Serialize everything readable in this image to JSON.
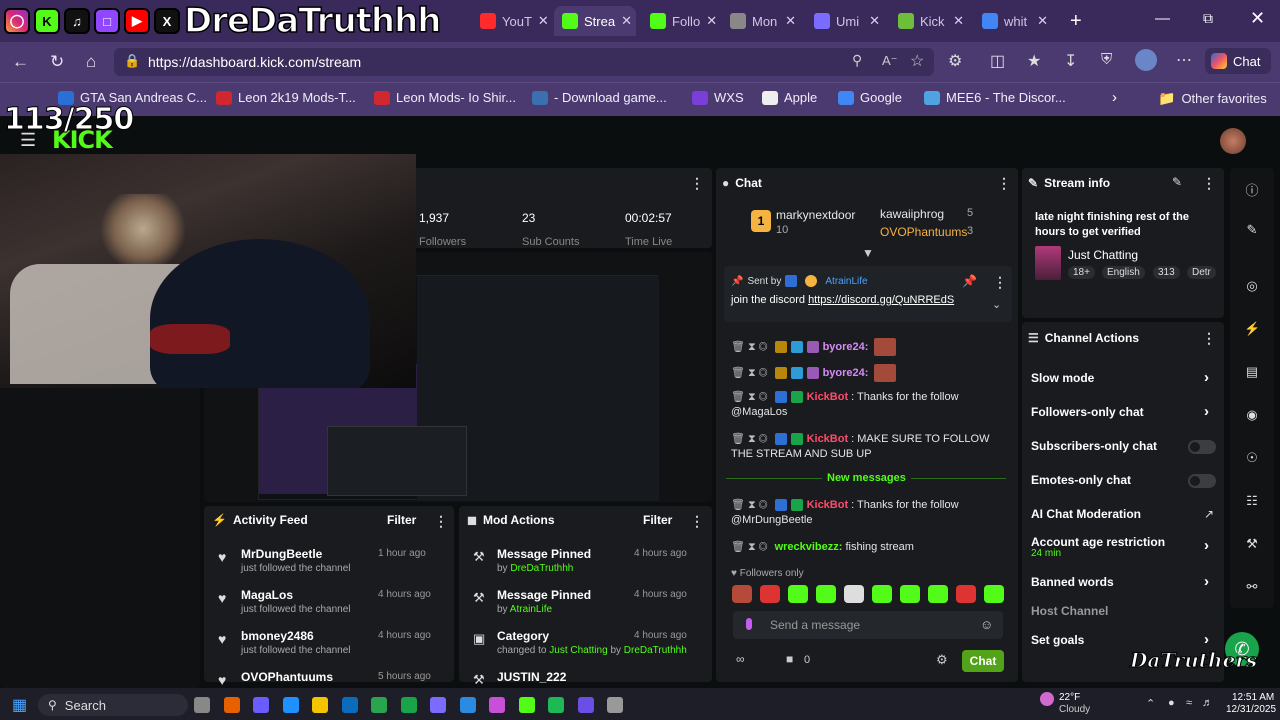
{
  "overlay": {
    "channel_name": "DreDaTruthhh",
    "goal_counter": "113/250",
    "social_icons": [
      "instagram-icon",
      "kick-icon",
      "tiktok-icon",
      "twitch-icon",
      "youtube-icon",
      "x-icon"
    ],
    "watermark": "DaTruthers"
  },
  "browser": {
    "tabs": [
      {
        "label": "YouT",
        "active": false,
        "color": "#ff2b2b"
      },
      {
        "label": "Strea",
        "active": true,
        "color": "#53fc18"
      },
      {
        "label": "Follo",
        "active": false,
        "color": "#53fc18"
      },
      {
        "label": "Mon",
        "active": false,
        "color": "#888888"
      },
      {
        "label": "Umi",
        "active": false,
        "color": "#7a6cff"
      },
      {
        "label": "Kick",
        "active": false,
        "color": "#6fbe3a"
      },
      {
        "label": "whit",
        "active": false,
        "color": "#4285f4"
      }
    ],
    "new_tab": "+",
    "url": "https://dashboard.kick.com/stream",
    "copilot_label": "Chat",
    "bookmarks": [
      {
        "label": "GTA San Andreas C...",
        "color": "#2a6fd6"
      },
      {
        "label": "Leon 2k19 Mods-T...",
        "color": "#d0282e"
      },
      {
        "label": "Leon Mods- Io Shir...",
        "color": "#d0282e"
      },
      {
        "label": "- Download game...",
        "color": "#3a6fb0"
      },
      {
        "label": "WXS",
        "color": "#7a3fd8"
      },
      {
        "label": "Apple",
        "color": "#eeeeee"
      },
      {
        "label": "Google",
        "color": "#4285f4"
      },
      {
        "label": "MEE6 - The Discor...",
        "color": "#4fa3e0"
      }
    ],
    "other_favorites": "Other favorites"
  },
  "dashboard": {
    "logo": "KICK",
    "stats": [
      {
        "value": "1,937",
        "label": "Followers"
      },
      {
        "value": "23",
        "label": "Sub Counts"
      },
      {
        "value": "00:02:57",
        "label": "Time Live"
      }
    ],
    "chat": {
      "title": "Chat",
      "leaderboard": [
        {
          "rank": "1",
          "name": "markynextdoor",
          "count": "10"
        },
        {
          "name": "kawaiiphrog",
          "count": "5"
        },
        {
          "name": "OVOPhantuums",
          "count": "3"
        }
      ],
      "pinned": {
        "sent_by_label": "Sent by",
        "sender": "AtrainLife",
        "text": "join the discord",
        "link": "https://discord.gg/QuNRREdS"
      },
      "messages": [
        {
          "user": "byore24:",
          "text": ""
        },
        {
          "user": "byore24:",
          "text": ""
        },
        {
          "user": "KickBot",
          "text": ": Thanks for the follow @MagaLos"
        },
        {
          "user": "KickBot",
          "text": ": MAKE SURE TO FOLLOW THE STREAM AND SUB UP"
        },
        {
          "user": "KickBot",
          "text": ": Thanks for the follow @MrDungBeetle"
        },
        {
          "user": "wreckvibezz:",
          "text": "fishing stream"
        }
      ],
      "new_messages": "New messages",
      "followers_only": "Followers only",
      "input_placeholder": "Send a message",
      "send_label": "Chat",
      "viewer_count": "0"
    },
    "stream_info": {
      "title": "Stream info",
      "stream_title": "late night finishing rest of the hours to get verified",
      "category": "Just Chatting",
      "tags": [
        "18+",
        "English",
        "313",
        "Detr"
      ]
    },
    "channel_actions": {
      "title": "Channel Actions",
      "items": [
        {
          "label": "Slow mode",
          "control": "chevron"
        },
        {
          "label": "Followers-only chat",
          "control": "chevron"
        },
        {
          "label": "Subscribers-only chat",
          "control": "toggle"
        },
        {
          "label": "Emotes-only chat",
          "control": "toggle"
        },
        {
          "label": "AI Chat Moderation",
          "control": "external"
        },
        {
          "label": "Account age restriction",
          "sub": "24 min",
          "control": "chevron"
        },
        {
          "label": "Banned words",
          "control": "chevron"
        },
        {
          "label": "Host Channel",
          "control": "none"
        },
        {
          "label": "Set goals",
          "control": "chevron"
        }
      ]
    },
    "activity_feed": {
      "title": "Activity Feed",
      "filter": "Filter",
      "items": [
        {
          "name": "MrDungBeetle",
          "sub": "just followed the channel",
          "time": "1 hour ago"
        },
        {
          "name": "MagaLos",
          "sub": "just followed the channel",
          "time": "4 hours ago"
        },
        {
          "name": "bmoney2486",
          "sub": "just followed the channel",
          "time": "4 hours ago"
        },
        {
          "name": "OVOPhantuums",
          "sub": "",
          "time": "5 hours ago"
        }
      ]
    },
    "mod_actions": {
      "title": "Mod Actions",
      "filter": "Filter",
      "items": [
        {
          "action": "Message Pinned",
          "by_label": "by",
          "by": "DreDaTruthhh",
          "time": "4 hours ago"
        },
        {
          "action": "Message Pinned",
          "by_label": "by",
          "by": "AtrainLife",
          "time": "4 hours ago"
        },
        {
          "action": "Category",
          "detail": "changed to",
          "target": "Just Chatting",
          "by_label": "by",
          "by": "DreDaTruthhh",
          "time": "4 hours ago"
        },
        {
          "action": "JUSTIN_222",
          "time": ""
        }
      ]
    }
  },
  "taskbar": {
    "search": "Search",
    "weather_temp": "22°F",
    "weather_desc": "Cloudy",
    "time": "12:51 AM",
    "date": "12/31/2025"
  }
}
